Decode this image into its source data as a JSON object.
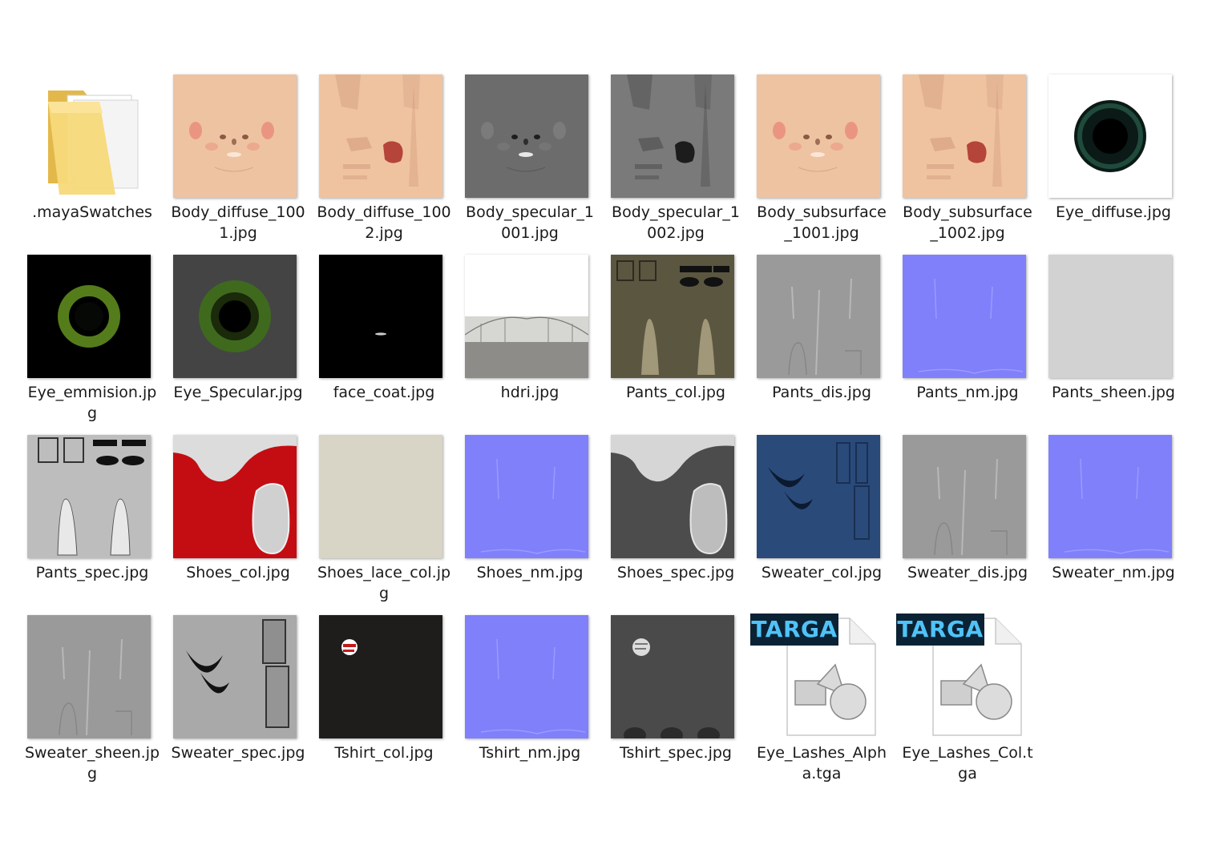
{
  "files": [
    {
      "name": "folder-maya-swatches",
      "label": ".mayaSwatches",
      "icon": "folder-icon"
    },
    {
      "name": "file-body-diffuse-1001",
      "label": "Body_diffuse_100\n1.jpg",
      "icon": "face-texture-thumbnail"
    },
    {
      "name": "file-body-diffuse-1002",
      "label": "Body_diffuse_100\n2.jpg",
      "icon": "body-texture-thumbnail"
    },
    {
      "name": "file-body-specular-1001",
      "label": "Body_specular_1\n001.jpg",
      "icon": "face-specular-thumbnail"
    },
    {
      "name": "file-body-specular-1002",
      "label": "Body_specular_1\n002.jpg",
      "icon": "body-specular-thumbnail"
    },
    {
      "name": "file-body-subsurface-1001",
      "label": "Body_subsurface\n_1001.jpg",
      "icon": "face-texture-thumbnail"
    },
    {
      "name": "file-body-subsurface-1002",
      "label": "Body_subsurface\n_1002.jpg",
      "icon": "body-texture-thumbnail"
    },
    {
      "name": "file-eye-diffuse",
      "label": "Eye_diffuse.jpg",
      "icon": "eye-thumbnail"
    },
    {
      "name": "file-eye-emmision",
      "label": "Eye_emmision.jp\ng",
      "icon": "eye-glow-thumbnail"
    },
    {
      "name": "file-eye-specular",
      "label": "Eye_Specular.jpg",
      "icon": "eye-specular-thumbnail"
    },
    {
      "name": "file-face-coat",
      "label": "face_coat.jpg",
      "icon": "black-thumbnail"
    },
    {
      "name": "file-hdri",
      "label": "hdri.jpg",
      "icon": "hdri-panorama-thumbnail"
    },
    {
      "name": "file-pants-col",
      "label": "Pants_col.jpg",
      "icon": "pants-color-thumbnail"
    },
    {
      "name": "file-pants-dis",
      "label": "Pants_dis.jpg",
      "icon": "grey-displacement-thumbnail"
    },
    {
      "name": "file-pants-nm",
      "label": "Pants_nm.jpg",
      "icon": "normal-map-thumbnail"
    },
    {
      "name": "file-pants-sheen",
      "label": "Pants_sheen.jpg",
      "icon": "noise-thumbnail"
    },
    {
      "name": "file-pants-spec",
      "label": "Pants_spec.jpg",
      "icon": "pants-spec-thumbnail"
    },
    {
      "name": "file-shoes-col",
      "label": "Shoes_col.jpg",
      "icon": "shoes-red-thumbnail"
    },
    {
      "name": "file-shoes-lace-col",
      "label": "Shoes_lace_col.jp\ng",
      "icon": "beige-thumbnail"
    },
    {
      "name": "file-shoes-nm",
      "label": "Shoes_nm.jpg",
      "icon": "normal-map-thumbnail"
    },
    {
      "name": "file-shoes-spec",
      "label": "Shoes_spec.jpg",
      "icon": "shoes-spec-thumbnail"
    },
    {
      "name": "file-sweater-col",
      "label": "Sweater_col.jpg",
      "icon": "sweater-blue-thumbnail"
    },
    {
      "name": "file-sweater-dis",
      "label": "Sweater_dis.jpg",
      "icon": "grey-displacement-thumbnail"
    },
    {
      "name": "file-sweater-nm",
      "label": "Sweater_nm.jpg",
      "icon": "normal-map-thumbnail"
    },
    {
      "name": "file-sweater-sheen",
      "label": "Sweater_sheen.jp\ng",
      "icon": "grey-displacement-thumbnail"
    },
    {
      "name": "file-sweater-spec",
      "label": "Sweater_spec.jpg",
      "icon": "sweater-spec-thumbnail"
    },
    {
      "name": "file-tshirt-col",
      "label": "Tshirt_col.jpg",
      "icon": "tshirt-dark-thumbnail"
    },
    {
      "name": "file-tshirt-nm",
      "label": "Tshirt_nm.jpg",
      "icon": "normal-map-thumbnail"
    },
    {
      "name": "file-tshirt-spec",
      "label": "Tshirt_spec.jpg",
      "icon": "tshirt-spec-thumbnail"
    },
    {
      "name": "file-eye-lashes-alpha",
      "label": "Eye_Lashes_Alph\na.tga",
      "icon": "targa-file-icon",
      "badge": "TARGA"
    },
    {
      "name": "file-eye-lashes-col",
      "label": "Eye_Lashes_Col.t\nga",
      "icon": "targa-file-icon",
      "badge": "TARGA"
    }
  ],
  "colors": {
    "skin": "#efc3a0",
    "normal": "#8080fb",
    "targa_badge_bg": "#0b2235",
    "targa_badge_text": "#4fc3f7"
  }
}
